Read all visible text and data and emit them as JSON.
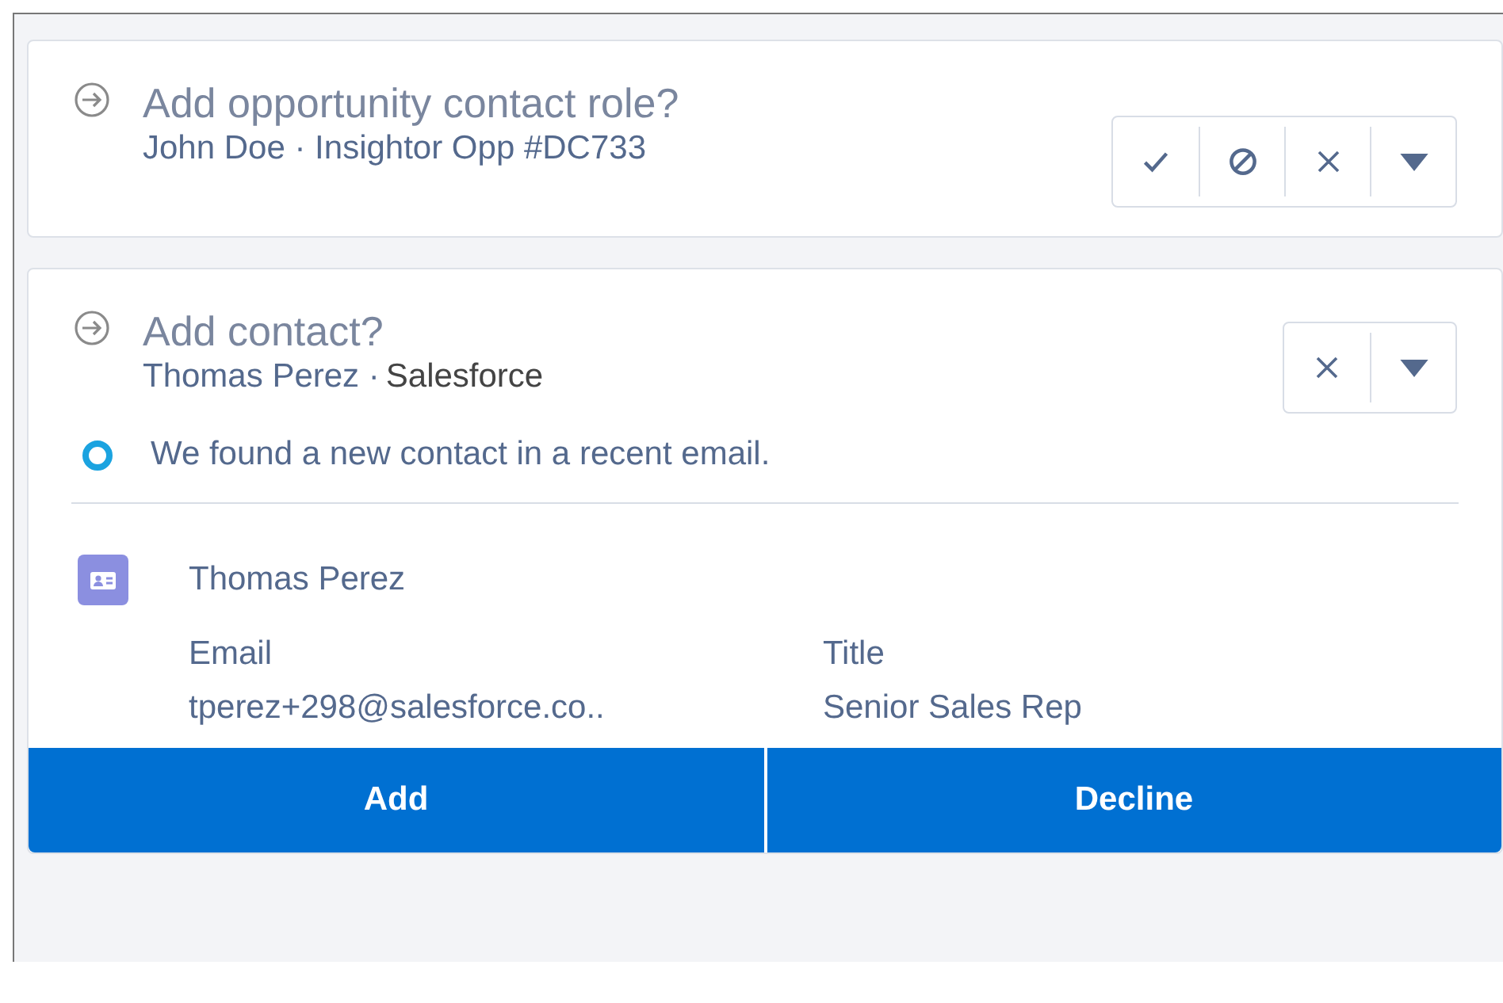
{
  "suggestions": [
    {
      "title": "Add opportunity contact role?",
      "subtitle": "John Doe · Insightor Opp #DC733",
      "actions": [
        {
          "kind": "accept"
        },
        {
          "kind": "block"
        },
        {
          "kind": "dismiss"
        },
        {
          "kind": "menu"
        }
      ]
    },
    {
      "title": "Add contact?",
      "subtitle": "Thomas Perez ·",
      "org": "Salesforce",
      "actions": [
        {
          "kind": "dismiss"
        },
        {
          "kind": "menu"
        }
      ],
      "notice": "We found a new contact in a recent email.",
      "contact": {
        "name": "Thomas Perez",
        "fields": [
          {
            "label": "Email",
            "value": "tperez+298@salesforce.co.."
          },
          {
            "label": "Title",
            "value": "Senior Sales Rep"
          }
        ]
      },
      "buttons": [
        "Add",
        "Decline"
      ]
    }
  ]
}
